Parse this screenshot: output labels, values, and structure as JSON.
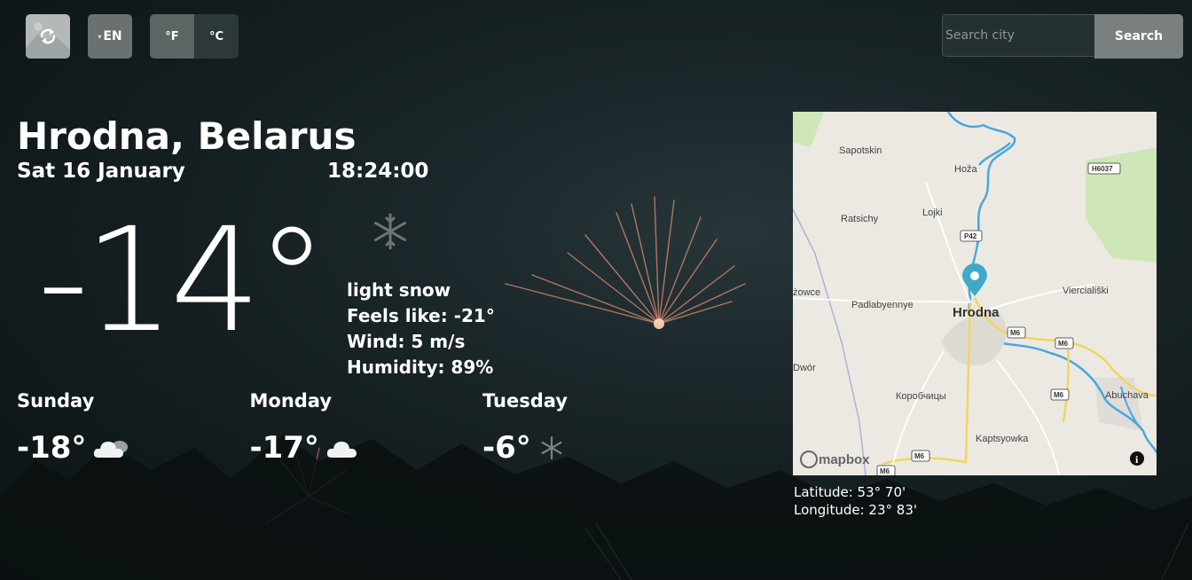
{
  "controls": {
    "refresh_icon": "refresh-icon",
    "language": "EN",
    "units": [
      "°F",
      "°C"
    ]
  },
  "search": {
    "placeholder": "Search city",
    "button_label": "Search"
  },
  "location": {
    "city": "Hrodna, Belarus",
    "date": "Sat 16 January",
    "time": "18:24:00"
  },
  "current": {
    "temperature": "-14°",
    "icon": "snowflake-icon",
    "description": "light snow",
    "feels_like": "Feels like: -21°",
    "wind": "Wind: 5 m/s",
    "humidity": "Humidity: 89%"
  },
  "forecast": [
    {
      "day": "Sunday",
      "temp": "-18°",
      "icon": "cloud-icon"
    },
    {
      "day": "Monday",
      "temp": "-17°",
      "icon": "cloud-icon"
    },
    {
      "day": "Tuesday",
      "temp": "-6°",
      "icon": "snowflake-icon"
    }
  ],
  "map": {
    "labels": {
      "sapotskin": "Sapotskin",
      "hoza": "Hoža",
      "h6037": "H6037",
      "ratsichy": "Ratsichy",
      "lojki": "Lojki",
      "p42": "P42",
      "zowce": "żowce",
      "padlabyennye": "Padlabyennye",
      "hrodna": "Hrodna",
      "viercialiski": "Vierciališki",
      "m6_a": "M6",
      "m6_b": "M6",
      "dwor": "Dwór",
      "korobchitsy": "Коробчицы",
      "m6_c": "M6",
      "abuchava": "Abuchava",
      "kaptsyowka": "Kaptsyowka",
      "m6_d": "M6",
      "m6_e": "M6",
      "mapbox": "mapbox",
      "info": "i"
    },
    "colors": {
      "land": "#ece9e3",
      "water": "#48a7e0",
      "park": "#cfe6b8",
      "road_major": "#f2d65a",
      "marker": "#3fa9c9"
    }
  },
  "coordinates": {
    "latitude": "Latitude: 53° 70'",
    "longitude": "Longitude: 23° 83'"
  }
}
